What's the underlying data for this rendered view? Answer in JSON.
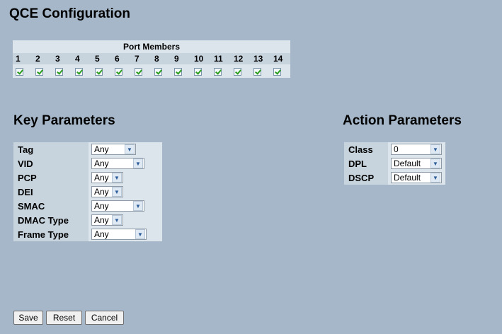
{
  "page_title": "QCE Configuration",
  "port_members": {
    "header": "Port Members",
    "ports": [
      "1",
      "2",
      "3",
      "4",
      "5",
      "6",
      "7",
      "8",
      "9",
      "10",
      "11",
      "12",
      "13",
      "14"
    ]
  },
  "key_parameters": {
    "title": "Key Parameters",
    "rows": [
      {
        "label": "Tag",
        "value": "Any"
      },
      {
        "label": "VID",
        "value": "Any"
      },
      {
        "label": "PCP",
        "value": "Any"
      },
      {
        "label": "DEI",
        "value": "Any"
      },
      {
        "label": "SMAC",
        "value": "Any"
      },
      {
        "label": "DMAC Type",
        "value": "Any"
      },
      {
        "label": "Frame Type",
        "value": "Any"
      }
    ]
  },
  "action_parameters": {
    "title": "Action Parameters",
    "rows": [
      {
        "label": "Class",
        "value": "0"
      },
      {
        "label": "DPL",
        "value": "Default"
      },
      {
        "label": "DSCP",
        "value": "Default"
      }
    ]
  },
  "buttons": {
    "save": "Save",
    "reset": "Reset",
    "cancel": "Cancel"
  }
}
